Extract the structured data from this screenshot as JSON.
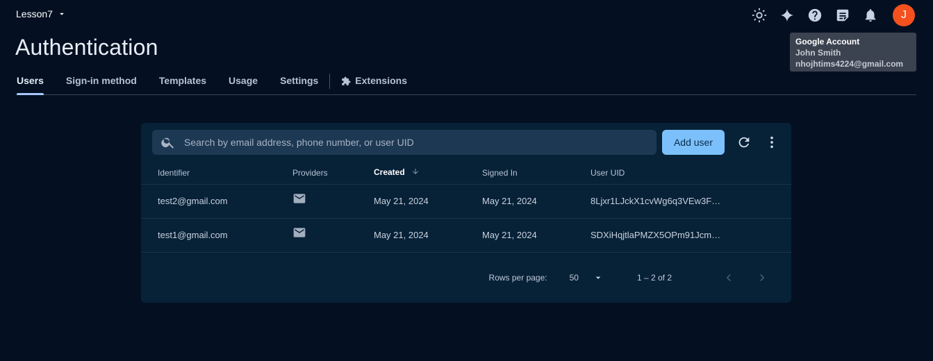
{
  "project": {
    "name": "Lesson7"
  },
  "page": {
    "title": "Authentication"
  },
  "top_icons": [
    "theme-icon",
    "gemini-spark-icon",
    "help-icon",
    "release-notes-icon",
    "notifications-icon"
  ],
  "account": {
    "avatar_letter": "J",
    "avatar_color": "#f4511e",
    "tooltip": {
      "title": "Google Account",
      "name": "John Smith",
      "email": "nhojhtims4224@gmail.com"
    }
  },
  "tabs": [
    {
      "label": "Users",
      "active": true
    },
    {
      "label": "Sign-in method"
    },
    {
      "label": "Templates"
    },
    {
      "label": "Usage"
    },
    {
      "label": "Settings"
    },
    {
      "label": "Extensions",
      "icon": "extensions-icon"
    }
  ],
  "toolbar": {
    "search_placeholder": "Search by email address, phone number, or user UID",
    "add_user_label": "Add user"
  },
  "table": {
    "columns": [
      "Identifier",
      "Providers",
      "Created",
      "Signed In",
      "User UID"
    ],
    "sorted_column": "Created",
    "rows": [
      {
        "identifier": "test2@gmail.com",
        "provider": "email-icon",
        "created": "May 21, 2024",
        "signed_in": "May 21, 2024",
        "uid": "8Ljxr1LJckX1cvWg6q3VEw3F…"
      },
      {
        "identifier": "test1@gmail.com",
        "provider": "email-icon",
        "created": "May 21, 2024",
        "signed_in": "May 21, 2024",
        "uid": "SDXiHqjtlaPMZX5OPm91Jcm…"
      }
    ]
  },
  "pagination": {
    "rows_per_page_label": "Rows per page:",
    "rows_per_page": "50",
    "range": "1 – 2 of 2"
  },
  "colors": {
    "background": "#041022",
    "card": "#072137",
    "accent": "#7cc0fb",
    "tab_indicator": "#a8c7fa"
  }
}
